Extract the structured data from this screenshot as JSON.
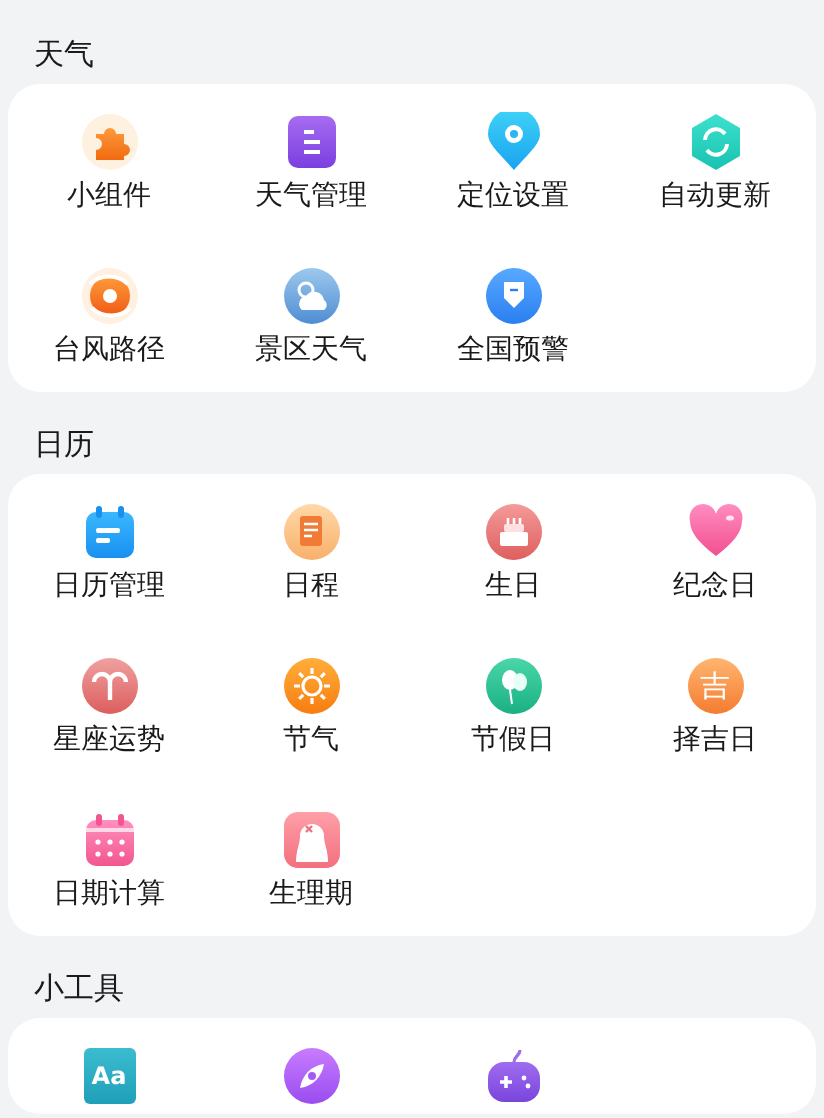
{
  "sections": [
    {
      "title": "天气",
      "items": [
        {
          "label": "小组件"
        },
        {
          "label": "天气管理"
        },
        {
          "label": "定位设置"
        },
        {
          "label": "自动更新"
        },
        {
          "label": "台风路径"
        },
        {
          "label": "景区天气"
        },
        {
          "label": "全国预警"
        }
      ]
    },
    {
      "title": "日历",
      "items": [
        {
          "label": "日历管理"
        },
        {
          "label": "日程"
        },
        {
          "label": "生日"
        },
        {
          "label": "纪念日"
        },
        {
          "label": "星座运势"
        },
        {
          "label": "节气"
        },
        {
          "label": "节假日"
        },
        {
          "label": "择吉日",
          "glyph": "吉"
        },
        {
          "label": "日期计算"
        },
        {
          "label": "生理期"
        }
      ]
    },
    {
      "title": "小工具",
      "items": [
        {
          "kind": "icon",
          "glyph": "Aa"
        },
        {
          "kind": "icon"
        },
        {
          "kind": "icon"
        }
      ]
    }
  ]
}
